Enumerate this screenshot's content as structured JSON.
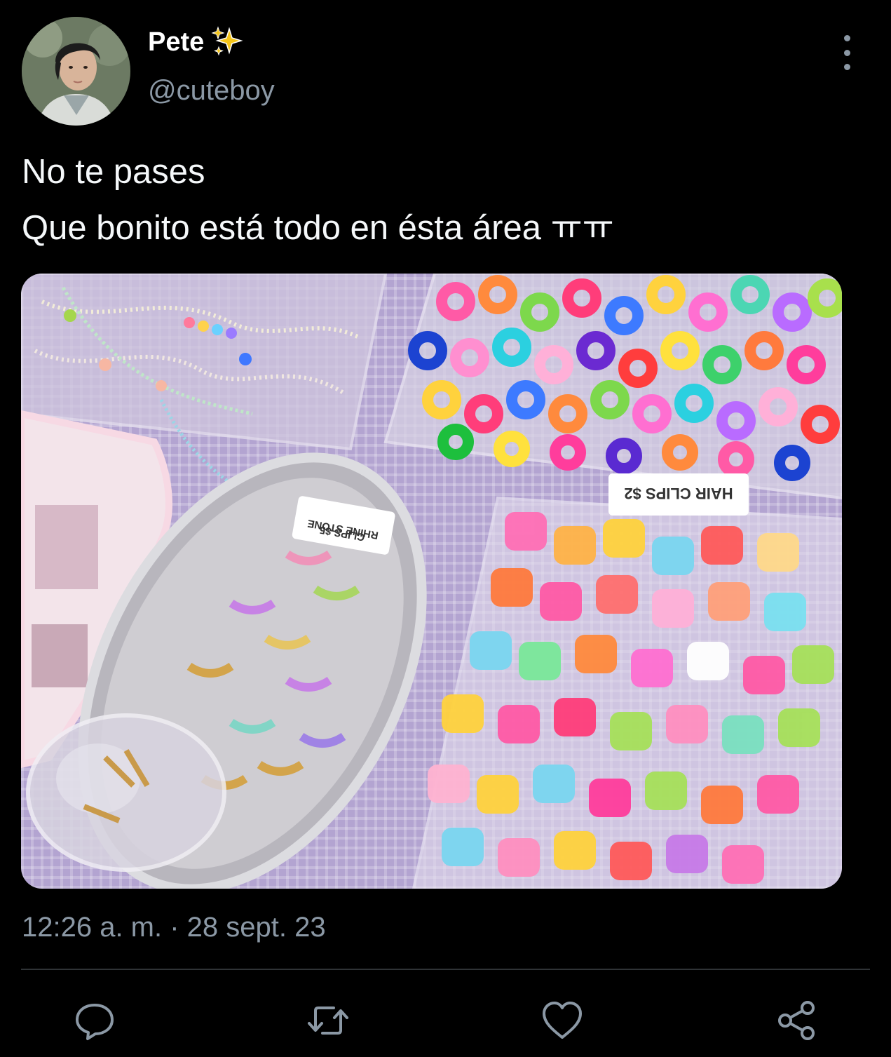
{
  "user": {
    "display_name": "Pete",
    "name_emoji": "sparkles-icon",
    "handle": "@cuteboy"
  },
  "tweet": {
    "lines": [
      "No te pases",
      "Que bonito está todo en ésta área ㅠㅠ"
    ],
    "timestamp": "12:26 a. m. · 28 sept. 23"
  },
  "media": {
    "sign_hair_clips": "HAIR CLIPS $2",
    "sign_rhinestone_clips_1": "RHINE STONE",
    "sign_rhinestone_clips_2": "CLIPS $5"
  },
  "actions": [
    "reply-icon",
    "retweet-icon",
    "like-icon",
    "share-icon"
  ],
  "colors": {
    "background": "#000000",
    "text": "#ffffff",
    "secondary_text": "#8b98a5",
    "divider": "#2f3336",
    "sparkle": "#f5c518"
  }
}
